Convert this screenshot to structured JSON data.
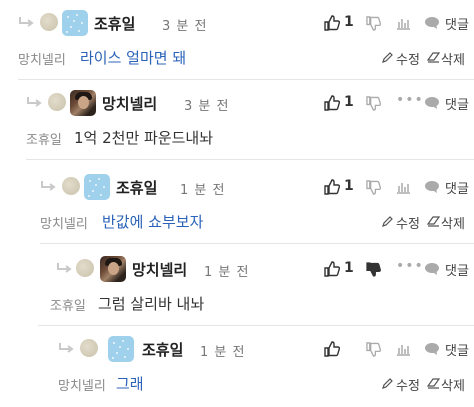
{
  "labels": {
    "reply": "댓글",
    "edit": "수정",
    "delete": "삭제"
  },
  "colors": {
    "link_blue": "#2b63b8",
    "separator": "#e6e6e6",
    "avatar_blue": "#9fd1ec"
  },
  "comments": [
    {
      "author": "조휴일",
      "avatar": "blue-avatar",
      "time": "3 분 전",
      "likes": "1",
      "reaction_icon": "stats-bar-icon",
      "mention": "망치넬리",
      "text": "라이스 얼마면 돼",
      "text_style": "blue",
      "editable": true
    },
    {
      "author": "망치넬리",
      "avatar": "photo-avatar",
      "time": "3 분 전",
      "likes": "1",
      "reaction_icon": "more-dots-icon",
      "mention": "조휴일",
      "text": "1억 2천만 파운드내놔",
      "text_style": "dark",
      "editable": false
    },
    {
      "author": "조휴일",
      "avatar": "blue-avatar",
      "time": "1 분 전",
      "likes": "1",
      "reaction_icon": "stats-bar-icon",
      "mention": "망치넬리",
      "text": "반값에 쇼부보자",
      "text_style": "blue",
      "editable": true
    },
    {
      "author": "망치넬리",
      "avatar": "photo-avatar",
      "time": "1 분 전",
      "likes": "1",
      "reaction_icon": "more-dots-icon",
      "mention": "조휴일",
      "text": "그럼 살리바 내놔",
      "text_style": "dark",
      "editable": false
    },
    {
      "author": "조휴일",
      "avatar": "blue-avatar",
      "time": "1 분 전",
      "likes": "",
      "reaction_icon": "stats-bar-icon",
      "mention": "망치넬리",
      "text": "그래",
      "text_style": "blue",
      "editable": true
    }
  ]
}
